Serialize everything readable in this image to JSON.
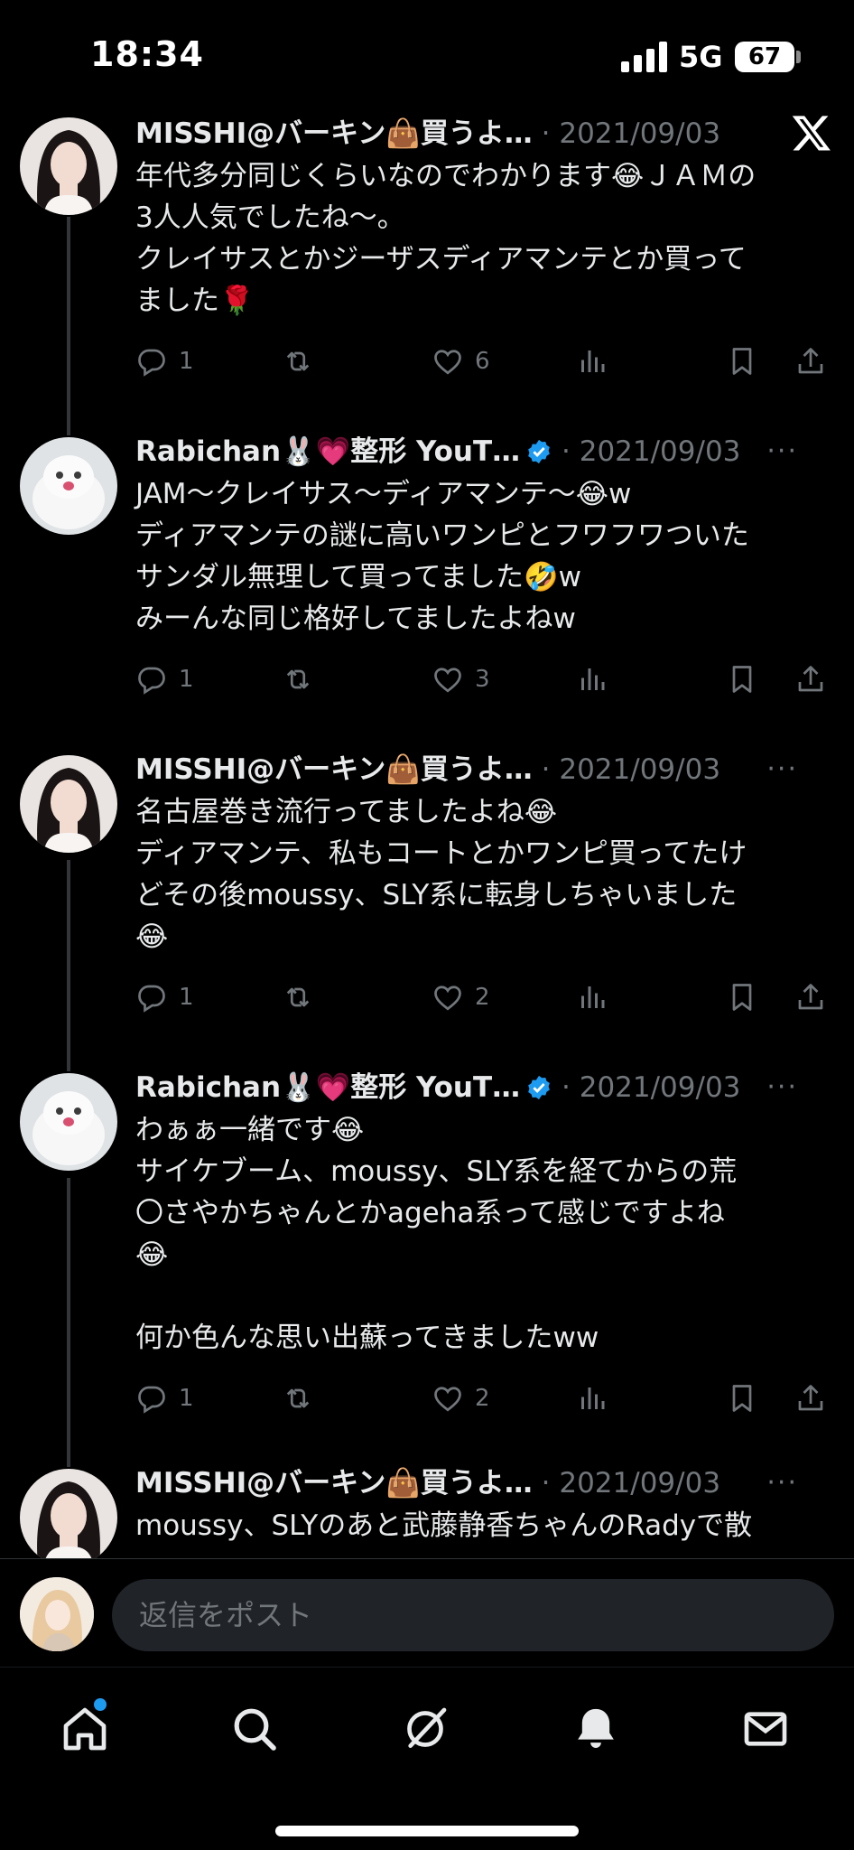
{
  "status_bar": {
    "time": "18:34",
    "network": "5G",
    "battery": "67"
  },
  "tweets": [
    {
      "author": "MISSHI@バーキン👜買うよ…",
      "date": "· 2021/09/03",
      "lines": [
        "年代多分同じくらいなのでわかります😂ＪＡＭの",
        "3人人気でしたね〜。",
        "クレイサスとかジーザスディアマンテとか買って",
        "ました🌹"
      ],
      "replies": "1",
      "likes": "6"
    },
    {
      "author": "Rabichan🐰💗整形 YouT…",
      "date": "· 2021/09/03",
      "more": "···",
      "lines": [
        "JAM〜クレイサス〜ディアマンテ〜😂w",
        "ディアマンテの謎に高いワンピとフワフワついた",
        "サンダル無理して買ってました🤣w",
        "みーんな同じ格好してましたよねw"
      ],
      "replies": "1",
      "likes": "3"
    },
    {
      "author": "MISSHI@バーキン👜買うよ…",
      "date": "· 2021/09/03",
      "more": "···",
      "lines": [
        "名古屋巻き流行ってましたよね😂",
        "ディアマンテ、私もコートとかワンピ買ってたけ",
        "どその後moussy、SLY系に転身しちゃいました",
        "😂"
      ],
      "replies": "1",
      "likes": "2"
    },
    {
      "author": "Rabichan🐰💗整形 YouT…",
      "date": "· 2021/09/03",
      "more": "···",
      "lines": [
        "わぁぁ一緒です😂",
        "サイケブーム、moussy、SLY系を経てからの荒",
        "〇さやかちゃんとかageha系って感じですよね",
        "😂",
        "",
        "何か色んな思い出蘇ってきましたww"
      ],
      "replies": "1",
      "likes": "2"
    },
    {
      "author": "MISSHI@バーキン👜買うよ…",
      "date": "· 2021/09/03",
      "more": "···",
      "lines": [
        "moussy、SLYのあと武藤静香ちゃんのRadyで散"
      ],
      "replies": "",
      "likes": ""
    }
  ],
  "reply": {
    "placeholder": "返信をポスト"
  },
  "icons": {
    "reply": "reply-icon",
    "repost": "repost-icon",
    "like": "heart-icon",
    "views": "views-icon",
    "bookmark": "bookmark-icon",
    "share": "share-icon",
    "nav": [
      "home-icon",
      "search-icon",
      "grok-icon",
      "bell-icon",
      "mail-icon"
    ]
  },
  "colors": {
    "background": "#000000",
    "text": "#e7e9ea",
    "secondary": "#71767b",
    "accent": "#1d9bf0",
    "thread_line": "#333639"
  }
}
